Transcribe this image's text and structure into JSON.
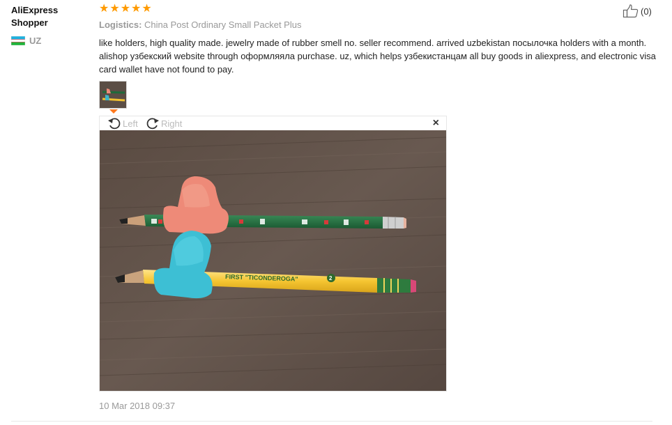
{
  "reviewer": {
    "name": "AliExpress Shopper",
    "country_code": "UZ"
  },
  "review": {
    "rating": 5,
    "stars": [
      "★",
      "★",
      "★",
      "★",
      "★"
    ],
    "logistics_label": "Logistics:",
    "logistics_value": "China Post Ordinary Small Packet Plus",
    "text": "like holders, high quality made. jewelry made of rubber smell no. seller recommend. arrived uzbekistan посылочка holders with a month. alishop узбекский website through оформляяла purchase. uz, which helps узбекистанцам all buy goods in aliexpress, and electronic visa card wallet have not found to pay.",
    "date": "10 Mar 2018 09:37"
  },
  "helpful": {
    "count": "(0)",
    "icon": "thumbs-up-icon"
  },
  "viewer": {
    "rotate_left_label": "Left",
    "rotate_right_label": "Right",
    "close_glyph": "×"
  },
  "photo": {
    "pencil1_print": "FIRST \"TICONDEROGA\"",
    "pencil1_grade": "2"
  },
  "colors": {
    "star": "#ff9a00",
    "accent_orange": "#ff7a1f",
    "muted_text": "#999999",
    "wood_background": "#5e5046"
  }
}
